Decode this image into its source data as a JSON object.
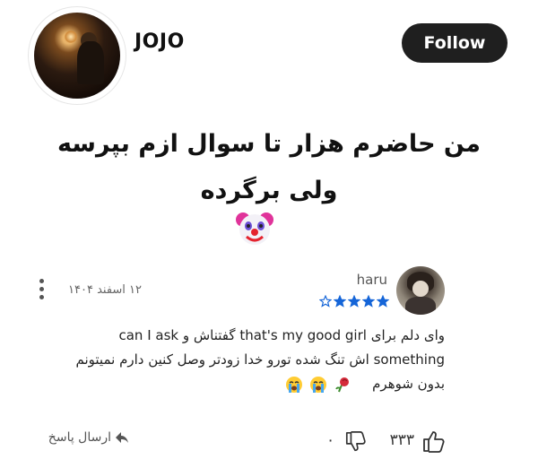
{
  "profile": {
    "username": "JOJO",
    "follow_label": "Follow"
  },
  "question": {
    "text": "من حاضرم هزار تا سوال ازم بپرسه ولی برگرده",
    "emoji": "clown-face"
  },
  "review": {
    "reviewer_name": "haru",
    "rating": 4,
    "rating_max": 5,
    "date": "۱۲ اسفند ۱۴۰۴",
    "line1": "وای دلم برای that's my good girl گفتناش و can I ask",
    "line2": "something اش تنگ شده تورو خدا زودتر وصل کنین دارم نمیتونم",
    "line3": "بدون شوهرم",
    "line3_emojis": [
      "crying-face",
      "crying-face",
      "wilted-rose"
    ],
    "like_count": "۳۳۳",
    "dislike_count": "۰",
    "reply_label": "ارسال پاسخ"
  },
  "colors": {
    "star": "#1565d8",
    "follow_bg": "#1f1f1f",
    "text": "#222222"
  }
}
